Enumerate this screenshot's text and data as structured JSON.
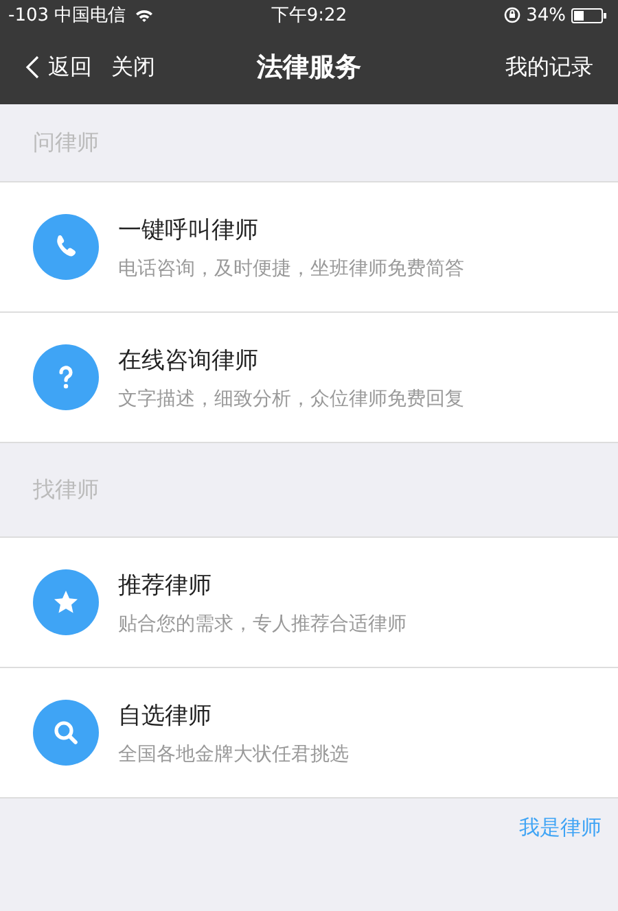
{
  "status_bar": {
    "carrier": "-103 中国电信",
    "time": "下午9:22",
    "battery": "34%"
  },
  "nav": {
    "back": "返回",
    "close": "关闭",
    "title": "法律服务",
    "action": "我的记录"
  },
  "sections": [
    {
      "title": "问律师",
      "items": [
        {
          "kind": "phone",
          "title": "一键呼叫律师",
          "subtitle": "电话咨询，及时便捷，坐班律师免费简答"
        },
        {
          "kind": "question",
          "title": "在线咨询律师",
          "subtitle": "文字描述，细致分析，众位律师免费回复"
        }
      ]
    },
    {
      "title": "找律师",
      "items": [
        {
          "kind": "star",
          "title": "推荐律师",
          "subtitle": "贴合您的需求，专人推荐合适律师"
        },
        {
          "kind": "search",
          "title": "自选律师",
          "subtitle": "全国各地金牌大状任君挑选"
        }
      ]
    }
  ],
  "footer_link": "我是律师"
}
